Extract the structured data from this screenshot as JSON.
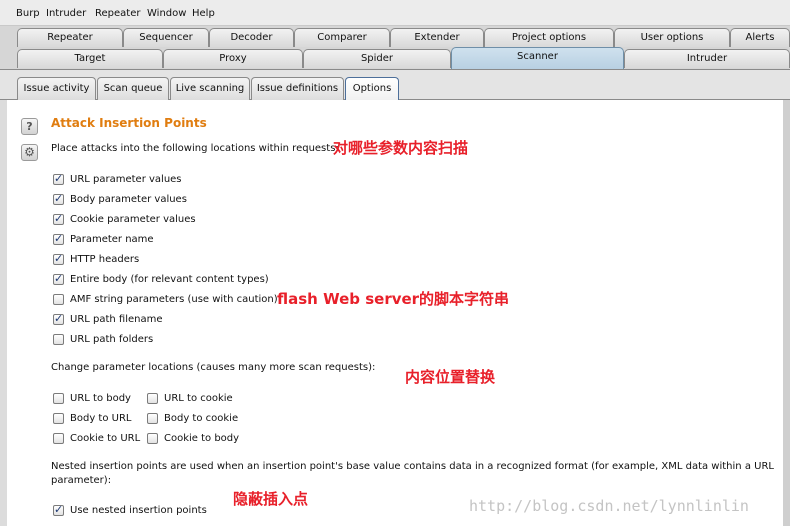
{
  "menu": [
    "Burp",
    "Intruder",
    "Repeater",
    "Window",
    "Help"
  ],
  "main_tabs_row1": [
    "Repeater",
    "Sequencer",
    "Decoder",
    "Comparer",
    "Extender",
    "Project options",
    "User options",
    "Alerts"
  ],
  "main_tabs_row2": [
    "Target",
    "Proxy",
    "Spider",
    "Scanner",
    "Intruder"
  ],
  "active_main_tab": "Scanner",
  "sub_tabs": [
    "Issue activity",
    "Scan queue",
    "Live scanning",
    "Issue definitions",
    "Options"
  ],
  "active_sub_tab": "Options",
  "section": {
    "title": "Attack Insertion Points",
    "intro": "Place attacks into the following locations within requests:",
    "locations": [
      {
        "label": "URL parameter values",
        "checked": true
      },
      {
        "label": "Body parameter values",
        "checked": true
      },
      {
        "label": "Cookie parameter values",
        "checked": true
      },
      {
        "label": "Parameter name",
        "checked": true
      },
      {
        "label": "HTTP headers",
        "checked": true
      },
      {
        "label": "Entire body (for relevant content types)",
        "checked": true
      },
      {
        "label": "AMF string parameters (use with caution)",
        "checked": false
      },
      {
        "label": "URL path filename",
        "checked": true
      },
      {
        "label": "URL path folders",
        "checked": false
      }
    ],
    "change_heading": "Change parameter locations (causes many more scan requests):",
    "change_left": [
      {
        "label": "URL to body",
        "checked": false
      },
      {
        "label": "Body to URL",
        "checked": false
      },
      {
        "label": "Cookie to URL",
        "checked": false
      }
    ],
    "change_right": [
      {
        "label": "URL to cookie",
        "checked": false
      },
      {
        "label": "Body to cookie",
        "checked": false
      },
      {
        "label": "Cookie to body",
        "checked": false
      }
    ],
    "nested_text_line1": "Nested insertion points are used when an insertion point's base value contains data in a recognized format (for example, XML data within a URL",
    "nested_text_line2": "parameter):",
    "nested_option": {
      "label": "Use nested insertion points",
      "checked": true
    }
  },
  "annotations": {
    "a1": "对哪些参数内容扫描",
    "a2": "flash Web server的脚本字符串",
    "a3": "内容位置替换",
    "a4": "隐蔽插入点"
  },
  "watermark": "http://blog.csdn.net/lynnlinlin",
  "help_icon_text": "?"
}
